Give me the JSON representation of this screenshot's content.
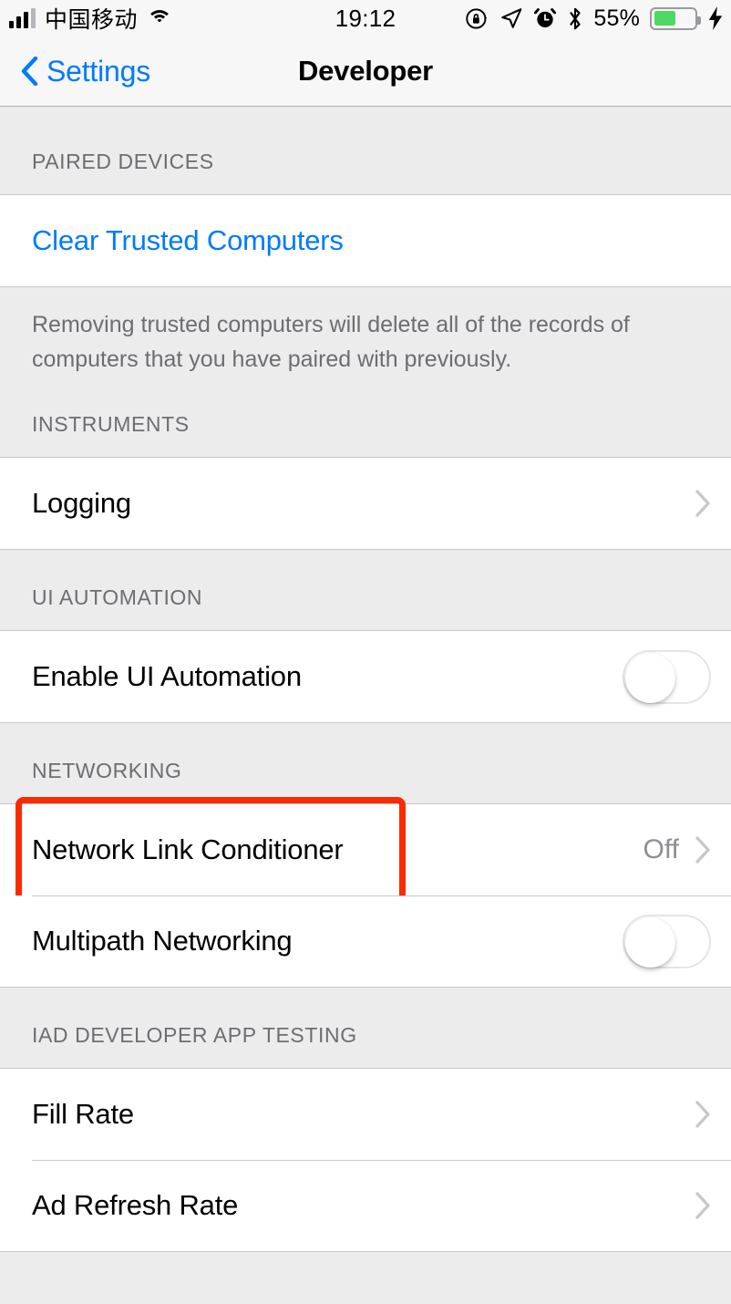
{
  "status_bar": {
    "carrier": "中国移动",
    "signal_bars_filled": 3,
    "signal_bars_total": 4,
    "wifi_icon": "wifi-icon",
    "time": "19:12",
    "rotation_lock_icon": "rotation-lock-icon",
    "location_icon": "location-arrow-icon",
    "alarm_icon": "alarm-clock-icon",
    "bluetooth_icon": "bluetooth-icon",
    "battery_percent": "55%",
    "battery_level": 55,
    "battery_color": "#4cd964",
    "charging_icon": "lightning-bolt-icon"
  },
  "navbar": {
    "back_label": "Settings",
    "back_icon": "chevron-left-icon",
    "title": "Developer"
  },
  "colors": {
    "accent": "#007aff",
    "highlight": "#fa2b00",
    "group_background": "#ececed",
    "cell_background": "#ffffff",
    "header_text": "#6d6d72",
    "value_text": "#8e8e93"
  },
  "sections": [
    {
      "header": "PAIRED DEVICES",
      "rows": [
        {
          "label": "Clear Trusted Computers",
          "type": "link"
        }
      ],
      "footer": "Removing trusted computers will delete all of the records of computers that you have paired with previously."
    },
    {
      "header": "INSTRUMENTS",
      "rows": [
        {
          "label": "Logging",
          "type": "disclosure"
        }
      ],
      "footer": ""
    },
    {
      "header": "UI AUTOMATION",
      "rows": [
        {
          "label": "Enable UI Automation",
          "type": "switch",
          "value": "off"
        }
      ],
      "footer": ""
    },
    {
      "header": "NETWORKING",
      "rows": [
        {
          "label": "Network Link Conditioner",
          "type": "disclosure",
          "value": "Off",
          "highlighted": true
        },
        {
          "label": "Multipath Networking",
          "type": "switch",
          "value": "off"
        }
      ],
      "footer": ""
    },
    {
      "header": "IAD DEVELOPER APP TESTING",
      "rows": [
        {
          "label": "Fill Rate",
          "type": "disclosure"
        },
        {
          "label": "Ad Refresh Rate",
          "type": "disclosure"
        }
      ],
      "footer": ""
    }
  ]
}
